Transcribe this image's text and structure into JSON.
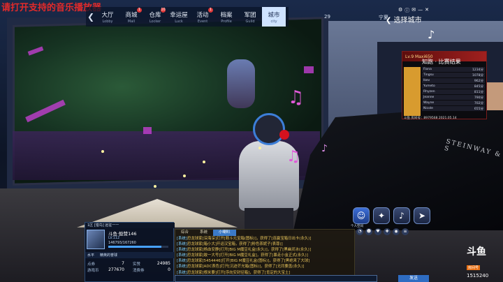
{
  "watermark": "请打开支持的音乐播放器",
  "nav": {
    "items": [
      {
        "label": "大厅",
        "sub": "Lobby",
        "badge": ""
      },
      {
        "label": "商城",
        "sub": "Mall",
        "badge": "1"
      },
      {
        "label": "仓库",
        "sub": "Locker",
        "badge": "10"
      },
      {
        "label": "幸运屋",
        "sub": "Luck",
        "badge": ""
      },
      {
        "label": "活动",
        "sub": "Event",
        "badge": "1"
      },
      {
        "label": "档案",
        "sub": "Profile",
        "badge": ""
      },
      {
        "label": "军团",
        "sub": "Guild",
        "badge": ""
      },
      {
        "label": "城市",
        "sub": "city",
        "badge": ""
      }
    ]
  },
  "server": {
    "left": "29",
    "right": "宁夏"
  },
  "city_select": "选择城市",
  "leaderboard": {
    "header": "Lv.9 Maxi650",
    "title": "知跑 · 比赛结果",
    "rows": [
      {
        "name": "Fiona",
        "score": "1234分"
      },
      {
        "name": "Tingsu",
        "score": "1078分"
      },
      {
        "name": "Ikev",
        "score": "962分"
      },
      {
        "name": "Yumeto",
        "score": "845分"
      },
      {
        "name": "Rhyzen",
        "score": "811分"
      },
      {
        "name": "Jeanne",
        "score": "790分"
      },
      {
        "name": "Wayne",
        "score": "702分"
      },
      {
        "name": "Nicole",
        "score": "655分"
      }
    ],
    "footer": "斗鱼 房间号：8979568  2021.05.14"
  },
  "piano_brand": "STEINWAY & S",
  "player": {
    "top": "1区  [猎鸟]  远征一一",
    "name": "斗鱼·鲶赞146",
    "level": "LV.112",
    "exp": "146793/167260",
    "exp_ratio": 0.88,
    "tabs": [
      "水平",
      "精英的誉球"
    ],
    "stats": [
      {
        "label": "点券",
        "value": "7"
      },
      {
        "label": "实赞",
        "value": "24985"
      },
      {
        "label": "游戏币",
        "value": "277670"
      },
      {
        "label": "消费券",
        "value": "0"
      }
    ]
  },
  "chat": {
    "tabs": [
      "综合",
      "系统",
      "小喇叭"
    ],
    "lines": [
      {
        "tag": "[系统]",
        "text": "恐龙球家[深海深]打开[菞斗元宝箱(图标)]，获得了[连赢宝箱日出卡(永久)]"
      },
      {
        "tag": "[系统]",
        "text": "恐龙球家[箱小大]开运汉宝箱，获得了[粉色茶妮子(表尊)]"
      },
      {
        "tag": "[系统]",
        "text": "恐龙球家[杨血安静]打开[BIG M魔豆礼盒(永久)]，获得了[黑幽灵冰(永久)]"
      },
      {
        "tag": "[系统]",
        "text": "恐龙球家[敢一大号]打开[BIG M魔豆礼盒]，获得了[暴走小金正式(永久)]"
      },
      {
        "tag": "[系统]",
        "text": "恐龙球家[5454446]打开[BIG M魔豆礼盒(图标)]，获得了[黑绝来了大球]"
      },
      {
        "tag": "[系统]",
        "text": "恐龙球家[ADC表色]打开[沉迹芒光箱(图标)]，获得了[无同要盖(永久)]"
      },
      {
        "tag": "[系统]",
        "text": "恐龙球家[根米要]打开[序向安封径箱]，获得了[肯定的大宝土]"
      }
    ],
    "send": "发送"
  },
  "skills": {
    "label": "个人空间",
    "icons": [
      "person-icon",
      "dance-icon",
      "music-icon",
      "sprint-icon"
    ]
  },
  "douyu": {
    "logo": "斗鱼",
    "sub": "房间号",
    "room": "1515240"
  },
  "colors": {
    "accent": "#3b7ac7",
    "chat_text": "#e6c35a",
    "watermark": "#e22a2a"
  }
}
